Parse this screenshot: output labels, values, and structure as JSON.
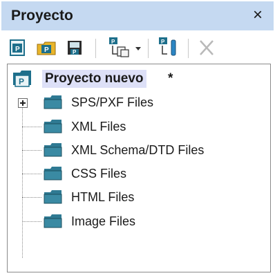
{
  "panel": {
    "title": "Proyecto",
    "close_label": "×"
  },
  "toolbar": {
    "buttons": [
      {
        "icon": "new-project-icon"
      },
      {
        "icon": "open-project-icon"
      },
      {
        "icon": "save-project-icon"
      },
      {
        "icon": "add-files-icon",
        "has_dropdown": true
      },
      {
        "icon": "project-properties-icon"
      },
      {
        "icon": "delete-icon"
      }
    ]
  },
  "tree": {
    "root": {
      "label": "Proyecto nuevo",
      "modified_marker": "*"
    },
    "folders": [
      {
        "label": "SPS/PXF Files",
        "expandable": true
      },
      {
        "label": "XML Files"
      },
      {
        "label": "XML Schema/DTD Files"
      },
      {
        "label": "CSS Files"
      },
      {
        "label": "HTML Files"
      },
      {
        "label": "Image Files"
      }
    ]
  },
  "colors": {
    "title_bar": "#c5d9f1",
    "root_highlight": "#dde0f7",
    "folder_fill": "#2f7a93",
    "project_icon": "#1d6f8b"
  }
}
